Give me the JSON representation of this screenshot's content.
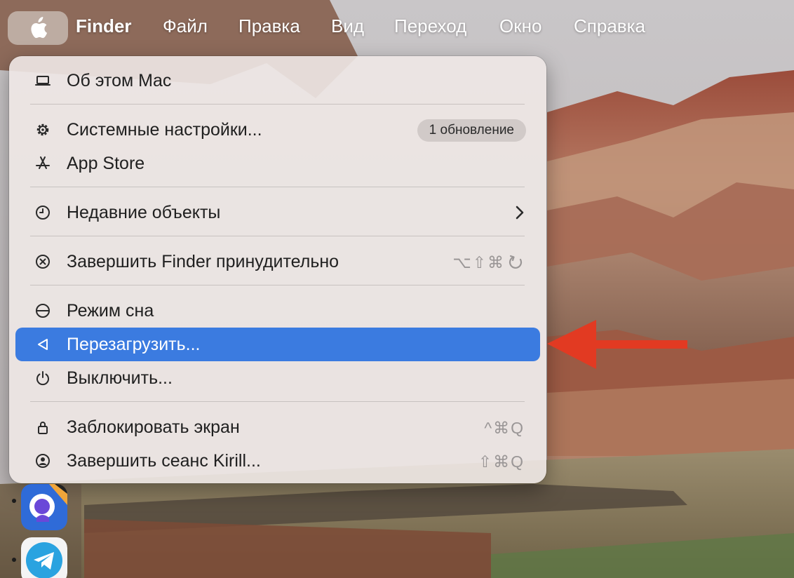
{
  "menubar": {
    "app_name": "Finder",
    "menus": [
      "Файл",
      "Правка",
      "Вид",
      "Переход",
      "Окно",
      "Справка"
    ]
  },
  "apple_menu": {
    "items": {
      "about": {
        "label": "Об этом Mac",
        "icon": "laptop-icon"
      },
      "settings": {
        "label": "Системные настройки...",
        "icon": "gear-icon",
        "badge": "1 обновление"
      },
      "appstore": {
        "label": "App Store",
        "icon": "appstore-icon"
      },
      "recent": {
        "label": "Недавние объекты",
        "icon": "clock-icon"
      },
      "forcequit": {
        "label": "Завершить Finder принудительно",
        "icon": "force-quit-icon",
        "shortcut": "⌥⇧⌘"
      },
      "sleep": {
        "label": "Режим сна",
        "icon": "sleep-icon"
      },
      "restart": {
        "label": "Перезагрузить...",
        "icon": "restart-icon",
        "selected": true
      },
      "shutdown": {
        "label": "Выключить...",
        "icon": "power-icon"
      },
      "lock": {
        "label": "Заблокировать экран",
        "icon": "lock-icon",
        "shortcut": "^⌘Q"
      },
      "logout": {
        "label": "Завершить сеанс Kirill...",
        "icon": "user-icon",
        "shortcut": "⇧⌘Q"
      }
    }
  },
  "colors": {
    "selection": "#3b7be0",
    "annotation_arrow": "#e23a22"
  },
  "dock": {
    "icons": [
      "search-app-icon",
      "telegram-icon"
    ]
  }
}
